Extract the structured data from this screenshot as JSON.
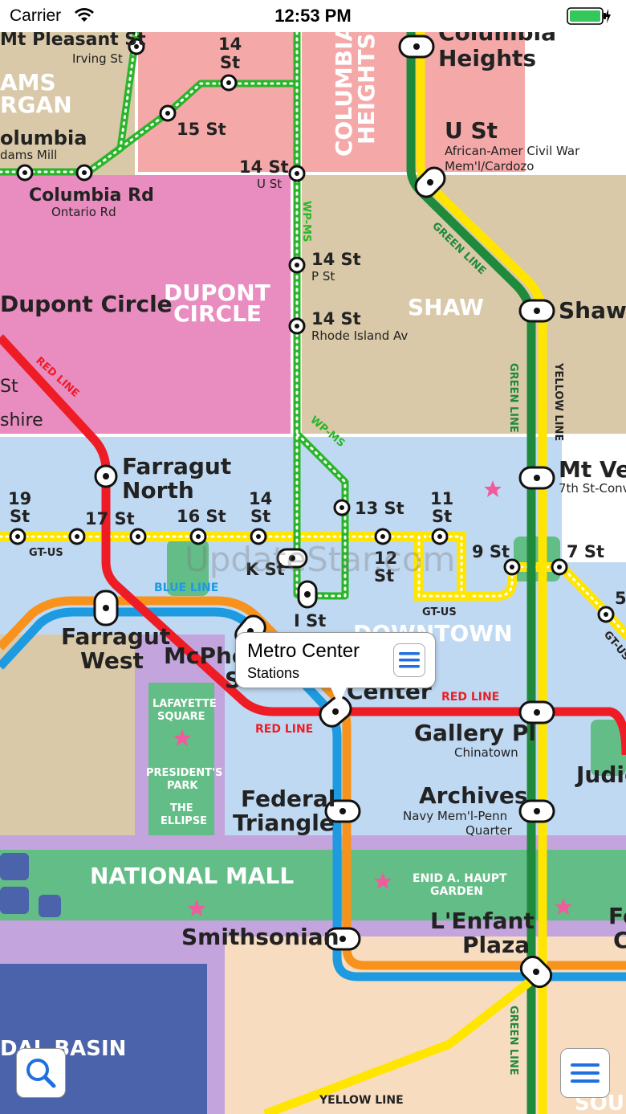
{
  "status_bar": {
    "carrier": "Carrier",
    "time": "12:53 PM"
  },
  "watermark": "UpdateStar.com",
  "callout": {
    "title": "Metro Center",
    "subtitle": "Stations"
  },
  "districts": {
    "adams_morgan_1": "AMS",
    "adams_morgan_2": "RGAN",
    "columbia_heights_1": "COLUMBIA",
    "columbia_heights_2": "HEIGHTS",
    "dupont_1": "DUPONT",
    "dupont_2": "CIRCLE",
    "shaw": "SHAW",
    "downtown": "DOWNTOWN",
    "lafayette_1": "LAFAYETTE",
    "lafayette_2": "SQUARE",
    "presidents_1": "PRESIDENT'S",
    "presidents_2": "PARK",
    "ellipse_1": "THE",
    "ellipse_2": "ELLIPSE",
    "national_mall": "NATIONAL MALL",
    "enid_1": "ENID A. HAUPT",
    "enid_2": "GARDEN",
    "tidal_basin": "DAL BASIN",
    "south": "SOU"
  },
  "line_labels": {
    "red_line_1": "RED LINE",
    "red_line_2": "RED LINE",
    "red_line_3": "RED LINE",
    "green_line_1": "GREEN LINE",
    "green_line_2": "GREEN LINE",
    "green_line_3": "GREEN LINE",
    "yellow_line_1": "YELLOW LINE",
    "yellow_line_2": "YELLOW LINE",
    "blue_line": "BLUE LINE",
    "wp_ms_1": "WP-MS",
    "wp_ms_2": "WP-MS",
    "gt_us_1": "GT-US",
    "gt_us_2": "GT-US",
    "gt_us_3": "GT-US"
  },
  "stations": {
    "mt_pleasant": "Mt Pleasant St",
    "irving": "Irving St",
    "st14_a": "14",
    "st14_b": "St",
    "st15": "15 St",
    "columbia_1": "olumbia",
    "columbia_2": "dams Mill",
    "columbia_rd": "Columbia Rd",
    "ontario": "Ontario Rd",
    "st14_u": "14 St",
    "u_st_sub": "U St",
    "columbia_heights_1": "Columbia",
    "columbia_heights_2": "Heights",
    "u_st": "U St",
    "u_st_sub1": "African-Amer Civil War",
    "u_st_sub2": "Mem'l/Cardozo",
    "dupont_circle": "Dupont Circle",
    "st14_p": "14 St",
    "p_st": "P St",
    "st14_ri": "14 St",
    "ri_av": "Rhode Island Av",
    "shaw": "Shaw",
    "st_left": "St",
    "shire": "shire",
    "farragut_north_1": "Farragut",
    "farragut_north_2": "North",
    "mt_vernon": "Mt Ve",
    "mt_vernon_sub": "7th St-Conv",
    "st19_a": "19",
    "st19_b": "St",
    "st17": "17 St",
    "st16": "16 St",
    "st14_k_a": "14",
    "st14_k_b": "St",
    "st13": "13 St",
    "st11_a": "11",
    "st11_b": "St",
    "st9": "9 St",
    "st7": "7 St",
    "st5": "5",
    "k_st": "K St",
    "st12_a": "12",
    "st12_b": "St",
    "i_st": "I St",
    "farragut_west_1": "Farragut",
    "farragut_west_2": "West",
    "mcpherson_1": "McPhe",
    "mcpherson_2": "S",
    "metro_center_2": "Center",
    "gallery_pl": "Gallery Pl",
    "chinatown": "Chinatown",
    "judiciary": "Judic",
    "federal_triangle_1": "Federal",
    "federal_triangle_2": "Triangle",
    "archives": "Archives",
    "archives_sub1": "Navy Mem'l-Penn",
    "archives_sub2": "Quarter",
    "smithsonian": "Smithsonian",
    "lenfant_1": "L'Enfant",
    "lenfant_2": "Plaza",
    "fed_center_1": "Fe",
    "fed_center_2": "C"
  },
  "colors": {
    "red": "#ee1c25",
    "green": "#1f8a3c",
    "yellow": "#ffe500",
    "orange": "#f7931d",
    "blue": "#1e9ae0",
    "silver_green": "#2ab52a",
    "district_tan": "#d9c9a8",
    "district_pink": "#f4a9a8",
    "district_magenta": "#e98cc0",
    "district_blue": "#c0d9f2",
    "park_green": "#63bd86",
    "water_blue": "#4a63aa",
    "lavender": "#c3a4dc",
    "peach": "#f7dcc0"
  },
  "icons": {
    "wifi": "wifi-icon",
    "battery": "battery-icon",
    "search": "search-icon",
    "menu": "list-icon"
  }
}
